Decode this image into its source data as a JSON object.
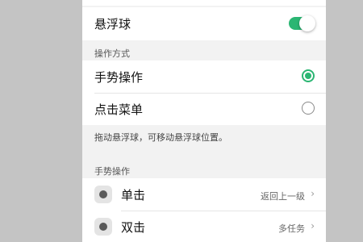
{
  "floating_ball": {
    "label": "悬浮球",
    "enabled": true
  },
  "operation_mode": {
    "header": "操作方式",
    "options": [
      {
        "label": "手势操作",
        "selected": true
      },
      {
        "label": "点击菜单",
        "selected": false
      }
    ]
  },
  "hint": "拖动悬浮球，可移动悬浮球位置。",
  "gestures": {
    "header": "手势操作",
    "items": [
      {
        "label": "单击",
        "value": "返回上一级"
      },
      {
        "label": "双击",
        "value": "多任务"
      }
    ]
  },
  "colors": {
    "accent": "#2bb673"
  }
}
